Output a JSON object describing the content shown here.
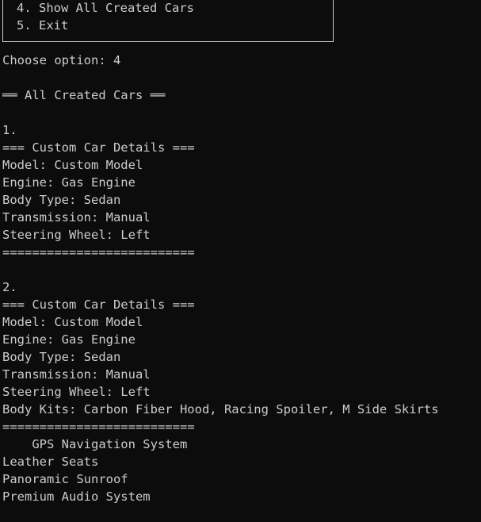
{
  "menu": {
    "option_show_all": "4. Show All Created Cars",
    "option_exit": "5. Exit"
  },
  "prompt": "Choose option: 4",
  "section_header": "══ All Created Cars ══",
  "cars": [
    {
      "index": "1.",
      "header": "=== Custom Car Details ===",
      "model": "Model: Custom Model",
      "engine": "Engine: Gas Engine",
      "body_type": "Body Type: Sedan",
      "transmission": "Transmission: Manual",
      "steering": "Steering Wheel: Left",
      "divider": "=========================="
    },
    {
      "index": "2.",
      "header": "=== Custom Car Details ===",
      "model": "Model: Custom Model",
      "engine": "Engine: Gas Engine",
      "body_type": "Body Type: Sedan",
      "transmission": "Transmission: Manual",
      "steering": "Steering Wheel: Left",
      "body_kits": "Body Kits: Carbon Fiber Hood, Racing Spoiler, M Side Skirts",
      "divider": "=========================="
    }
  ],
  "extras": {
    "gps": "    GPS Navigation System",
    "leather": "Leather Seats",
    "sunroof": "Panoramic Sunroof",
    "audio": "Premium Audio System"
  }
}
